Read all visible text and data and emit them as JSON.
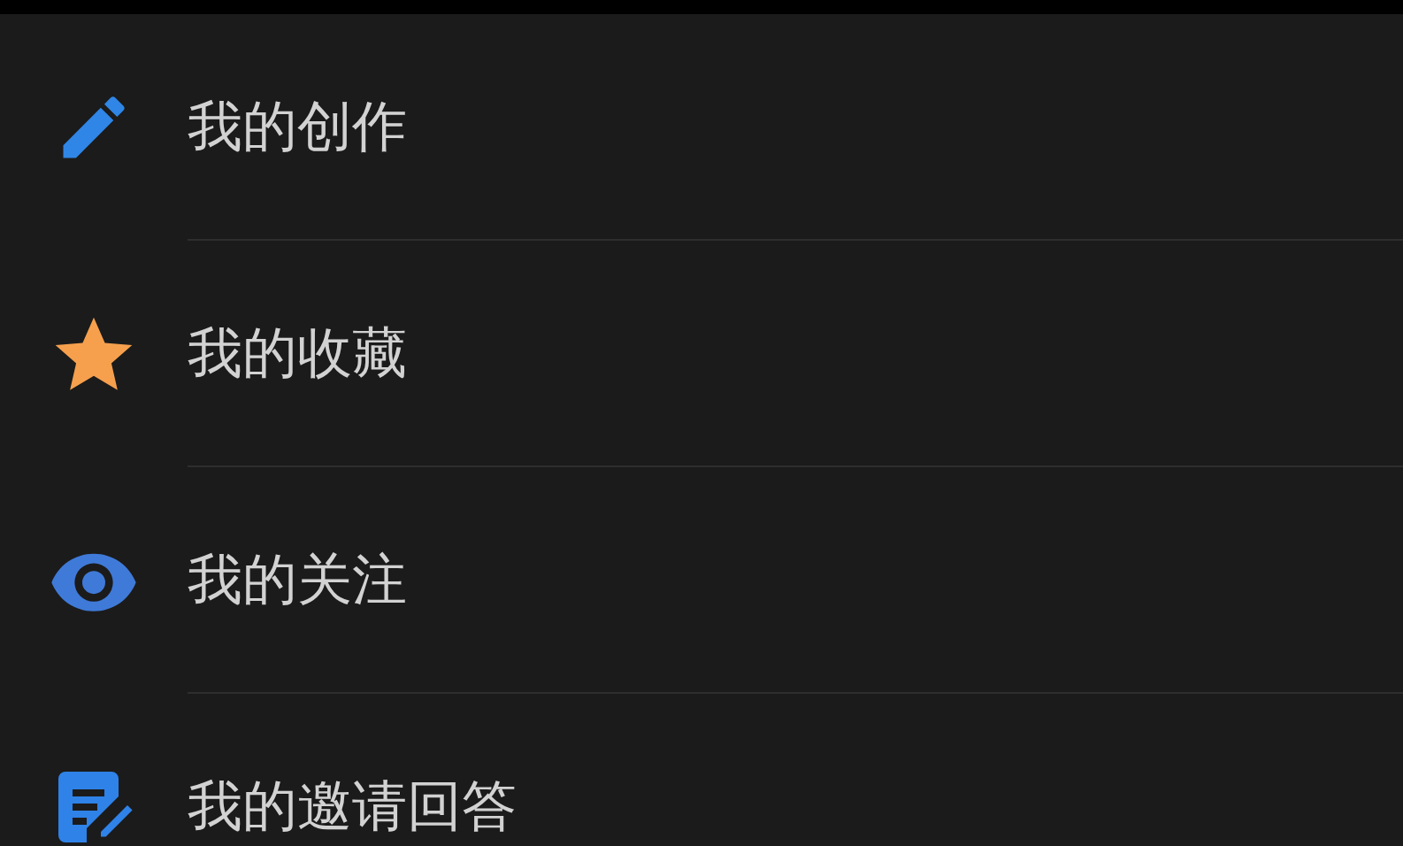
{
  "menu_items": [
    {
      "label": "我的创作",
      "kind": "pencil"
    },
    {
      "label": "我的收藏",
      "kind": "star"
    },
    {
      "label": "我的关注",
      "kind": "eye"
    },
    {
      "label": "我的邀请回答",
      "kind": "note"
    }
  ]
}
